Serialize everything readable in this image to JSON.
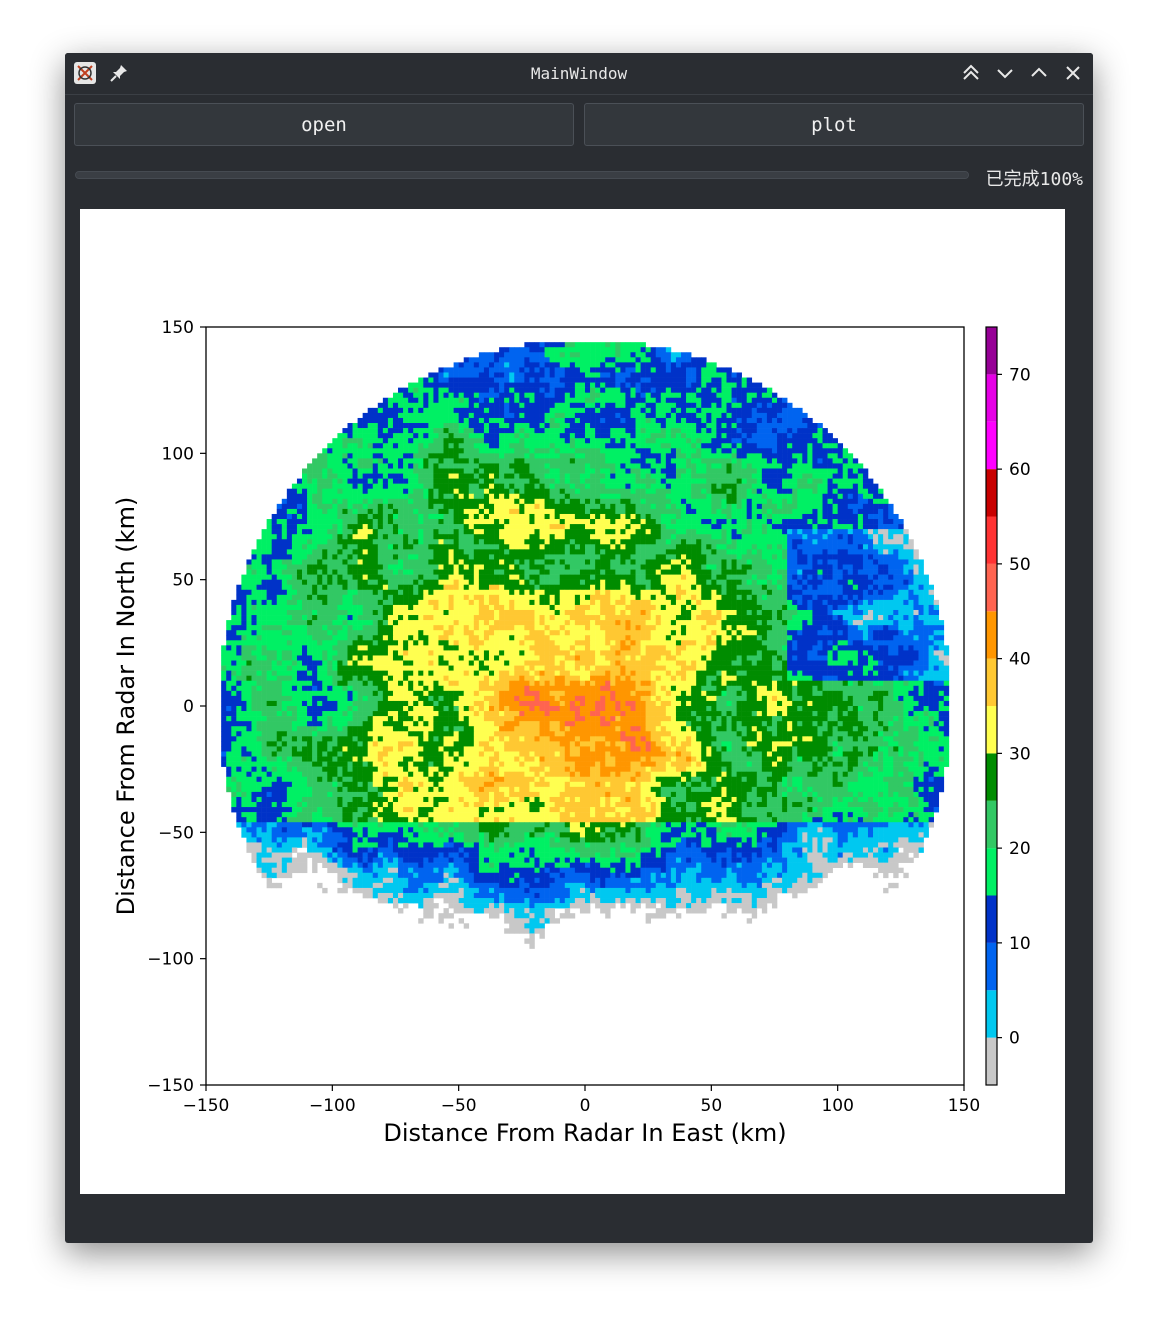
{
  "window": {
    "title": "MainWindow"
  },
  "toolbar": {
    "open_label": "open",
    "plot_label": "plot"
  },
  "progress": {
    "text": "已完成100%",
    "value": 1.0
  },
  "chart_data": {
    "type": "heatmap",
    "title": "",
    "xlabel": "Distance From Radar In East (km)",
    "ylabel": "Distance From Radar In North (km)",
    "xlim": [
      -150,
      150
    ],
    "ylim": [
      -150,
      150
    ],
    "x_ticks": [
      -150,
      -100,
      -50,
      0,
      50,
      100,
      150
    ],
    "y_ticks": [
      -150,
      -100,
      -50,
      0,
      50,
      100,
      150
    ],
    "x_tick_labels": [
      "−150",
      "−100",
      "−50",
      "0",
      "50",
      "100",
      "150"
    ],
    "y_tick_labels": [
      "−150",
      "−100",
      "−50",
      "0",
      "50",
      "100",
      "150"
    ],
    "colorbar": {
      "range": [
        -5,
        75
      ],
      "ticks": [
        0,
        10,
        20,
        30,
        40,
        50,
        60,
        70
      ],
      "tick_labels": [
        "0",
        "10",
        "20",
        "30",
        "40",
        "50",
        "60",
        "70"
      ],
      "levels": [
        {
          "from": -5,
          "to": 0,
          "color": "#c8c8c8"
        },
        {
          "from": 0,
          "to": 5,
          "color": "#00c8f0"
        },
        {
          "from": 5,
          "to": 10,
          "color": "#0064f0"
        },
        {
          "from": 10,
          "to": 15,
          "color": "#0032c8"
        },
        {
          "from": 15,
          "to": 20,
          "color": "#00f064"
        },
        {
          "from": 20,
          "to": 25,
          "color": "#32c864"
        },
        {
          "from": 25,
          "to": 30,
          "color": "#008c00"
        },
        {
          "from": 30,
          "to": 35,
          "color": "#ffff50"
        },
        {
          "from": 35,
          "to": 40,
          "color": "#ffc832"
        },
        {
          "from": 40,
          "to": 45,
          "color": "#ff9600"
        },
        {
          "from": 45,
          "to": 50,
          "color": "#ff6450"
        },
        {
          "from": 50,
          "to": 55,
          "color": "#ff3232"
        },
        {
          "from": 55,
          "to": 60,
          "color": "#c80000"
        },
        {
          "from": 60,
          "to": 65,
          "color": "#ff00ff"
        },
        {
          "from": 65,
          "to": 70,
          "color": "#e600e6"
        },
        {
          "from": 70,
          "to": 75,
          "color": "#960096"
        }
      ]
    },
    "radar_range_km": 145
  }
}
